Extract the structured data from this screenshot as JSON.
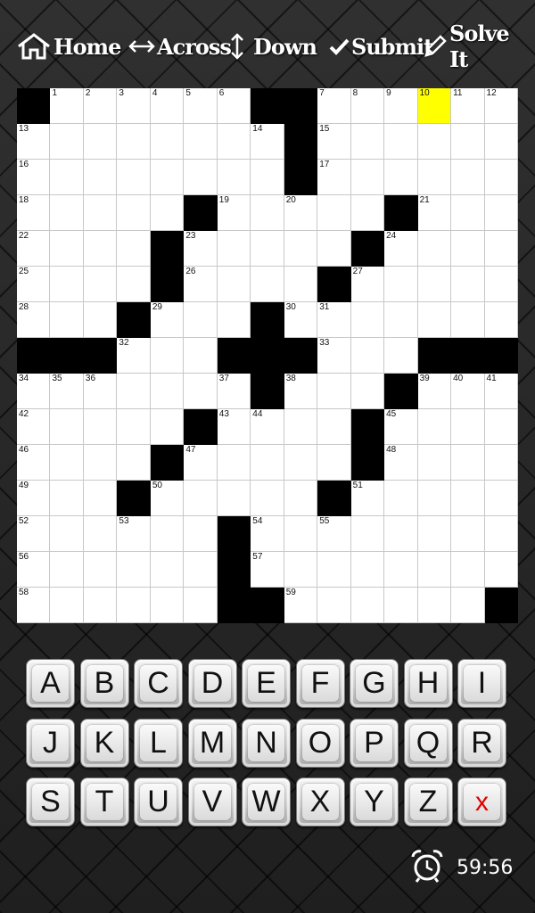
{
  "toolbar": {
    "home_label": "Home",
    "across_label": "Across",
    "down_label": "Down",
    "submit_label": "Submit",
    "solve_label": "Solve It",
    "icons": [
      "home-icon",
      "horizontal-arrows-icon",
      "vertical-arrows-icon",
      "checkmark-icon",
      "pencil-icon"
    ]
  },
  "grid": {
    "cols": 15,
    "rows": 15,
    "selected": "10",
    "pattern": [
      "#.....##.....",
      "",
      "",
      "",
      "",
      "",
      "",
      "",
      "",
      "",
      "",
      "",
      "",
      "",
      ""
    ],
    "blacks": [
      [
        0,
        0
      ],
      [
        0,
        7
      ],
      [
        0,
        8
      ],
      [
        1,
        8
      ],
      [
        2,
        8
      ],
      [
        3,
        5
      ],
      [
        3,
        11
      ],
      [
        4,
        4
      ],
      [
        4,
        10
      ],
      [
        5,
        4
      ],
      [
        5,
        9
      ],
      [
        6,
        3
      ],
      [
        6,
        7
      ],
      [
        7,
        0
      ],
      [
        7,
        1
      ],
      [
        7,
        2
      ],
      [
        7,
        6
      ],
      [
        7,
        7
      ],
      [
        7,
        8
      ],
      [
        7,
        12
      ],
      [
        7,
        13
      ],
      [
        7,
        14
      ],
      [
        8,
        7
      ],
      [
        8,
        11
      ],
      [
        9,
        5
      ],
      [
        9,
        10
      ],
      [
        10,
        4
      ],
      [
        10,
        10
      ],
      [
        11,
        3
      ],
      [
        11,
        9
      ],
      [
        12,
        6
      ],
      [
        13,
        6
      ],
      [
        14,
        6
      ],
      [
        14,
        7
      ],
      [
        14,
        14
      ]
    ],
    "numbers": [
      [
        0,
        1,
        "1"
      ],
      [
        0,
        2,
        "2"
      ],
      [
        0,
        3,
        "3"
      ],
      [
        0,
        4,
        "4"
      ],
      [
        0,
        5,
        "5"
      ],
      [
        0,
        6,
        "6"
      ],
      [
        0,
        9,
        "7"
      ],
      [
        0,
        10,
        "8"
      ],
      [
        0,
        11,
        "9"
      ],
      [
        0,
        12,
        "10"
      ],
      [
        0,
        13,
        "11"
      ],
      [
        0,
        14,
        "12"
      ],
      [
        1,
        0,
        "13"
      ],
      [
        1,
        7,
        "14"
      ],
      [
        1,
        9,
        "15"
      ],
      [
        2,
        0,
        "16"
      ],
      [
        2,
        9,
        "17"
      ],
      [
        3,
        0,
        "18"
      ],
      [
        3,
        6,
        "19"
      ],
      [
        3,
        8,
        "20"
      ],
      [
        3,
        12,
        "21"
      ],
      [
        4,
        0,
        "22"
      ],
      [
        4,
        5,
        "23"
      ],
      [
        4,
        11,
        "24"
      ],
      [
        5,
        0,
        "25"
      ],
      [
        5,
        5,
        "26"
      ],
      [
        5,
        10,
        "27"
      ],
      [
        6,
        0,
        "28"
      ],
      [
        6,
        4,
        "29"
      ],
      [
        6,
        8,
        "30"
      ],
      [
        6,
        9,
        "31"
      ],
      [
        7,
        3,
        "32"
      ],
      [
        7,
        9,
        "33"
      ],
      [
        8,
        0,
        "34"
      ],
      [
        8,
        1,
        "35"
      ],
      [
        8,
        2,
        "36"
      ],
      [
        8,
        6,
        "37"
      ],
      [
        8,
        8,
        "38"
      ],
      [
        8,
        12,
        "39"
      ],
      [
        8,
        13,
        "40"
      ],
      [
        8,
        14,
        "41"
      ],
      [
        9,
        0,
        "42"
      ],
      [
        9,
        6,
        "43"
      ],
      [
        9,
        7,
        "44"
      ],
      [
        9,
        11,
        "45"
      ],
      [
        10,
        0,
        "46"
      ],
      [
        10,
        5,
        "47"
      ],
      [
        10,
        11,
        "48"
      ],
      [
        11,
        0,
        "49"
      ],
      [
        11,
        4,
        "50"
      ],
      [
        11,
        10,
        "51"
      ],
      [
        12,
        0,
        "52"
      ],
      [
        12,
        3,
        "53"
      ],
      [
        12,
        7,
        "54"
      ],
      [
        12,
        9,
        "55"
      ],
      [
        13,
        0,
        "56"
      ],
      [
        13,
        7,
        "57"
      ],
      [
        14,
        0,
        "58"
      ],
      [
        14,
        8,
        "59"
      ]
    ],
    "selected_color": "#ffff00"
  },
  "keyboard": {
    "rows": [
      [
        "A",
        "B",
        "C",
        "D",
        "E",
        "F",
        "G",
        "H",
        "I"
      ],
      [
        "J",
        "K",
        "L",
        "M",
        "N",
        "O",
        "P",
        "Q",
        "R"
      ],
      [
        "S",
        "T",
        "U",
        "V",
        "W",
        "X",
        "Y",
        "Z",
        "x"
      ]
    ],
    "delete_color": "#e00000"
  },
  "timer": {
    "icon": "alarm-clock-icon",
    "value": "59:56"
  }
}
